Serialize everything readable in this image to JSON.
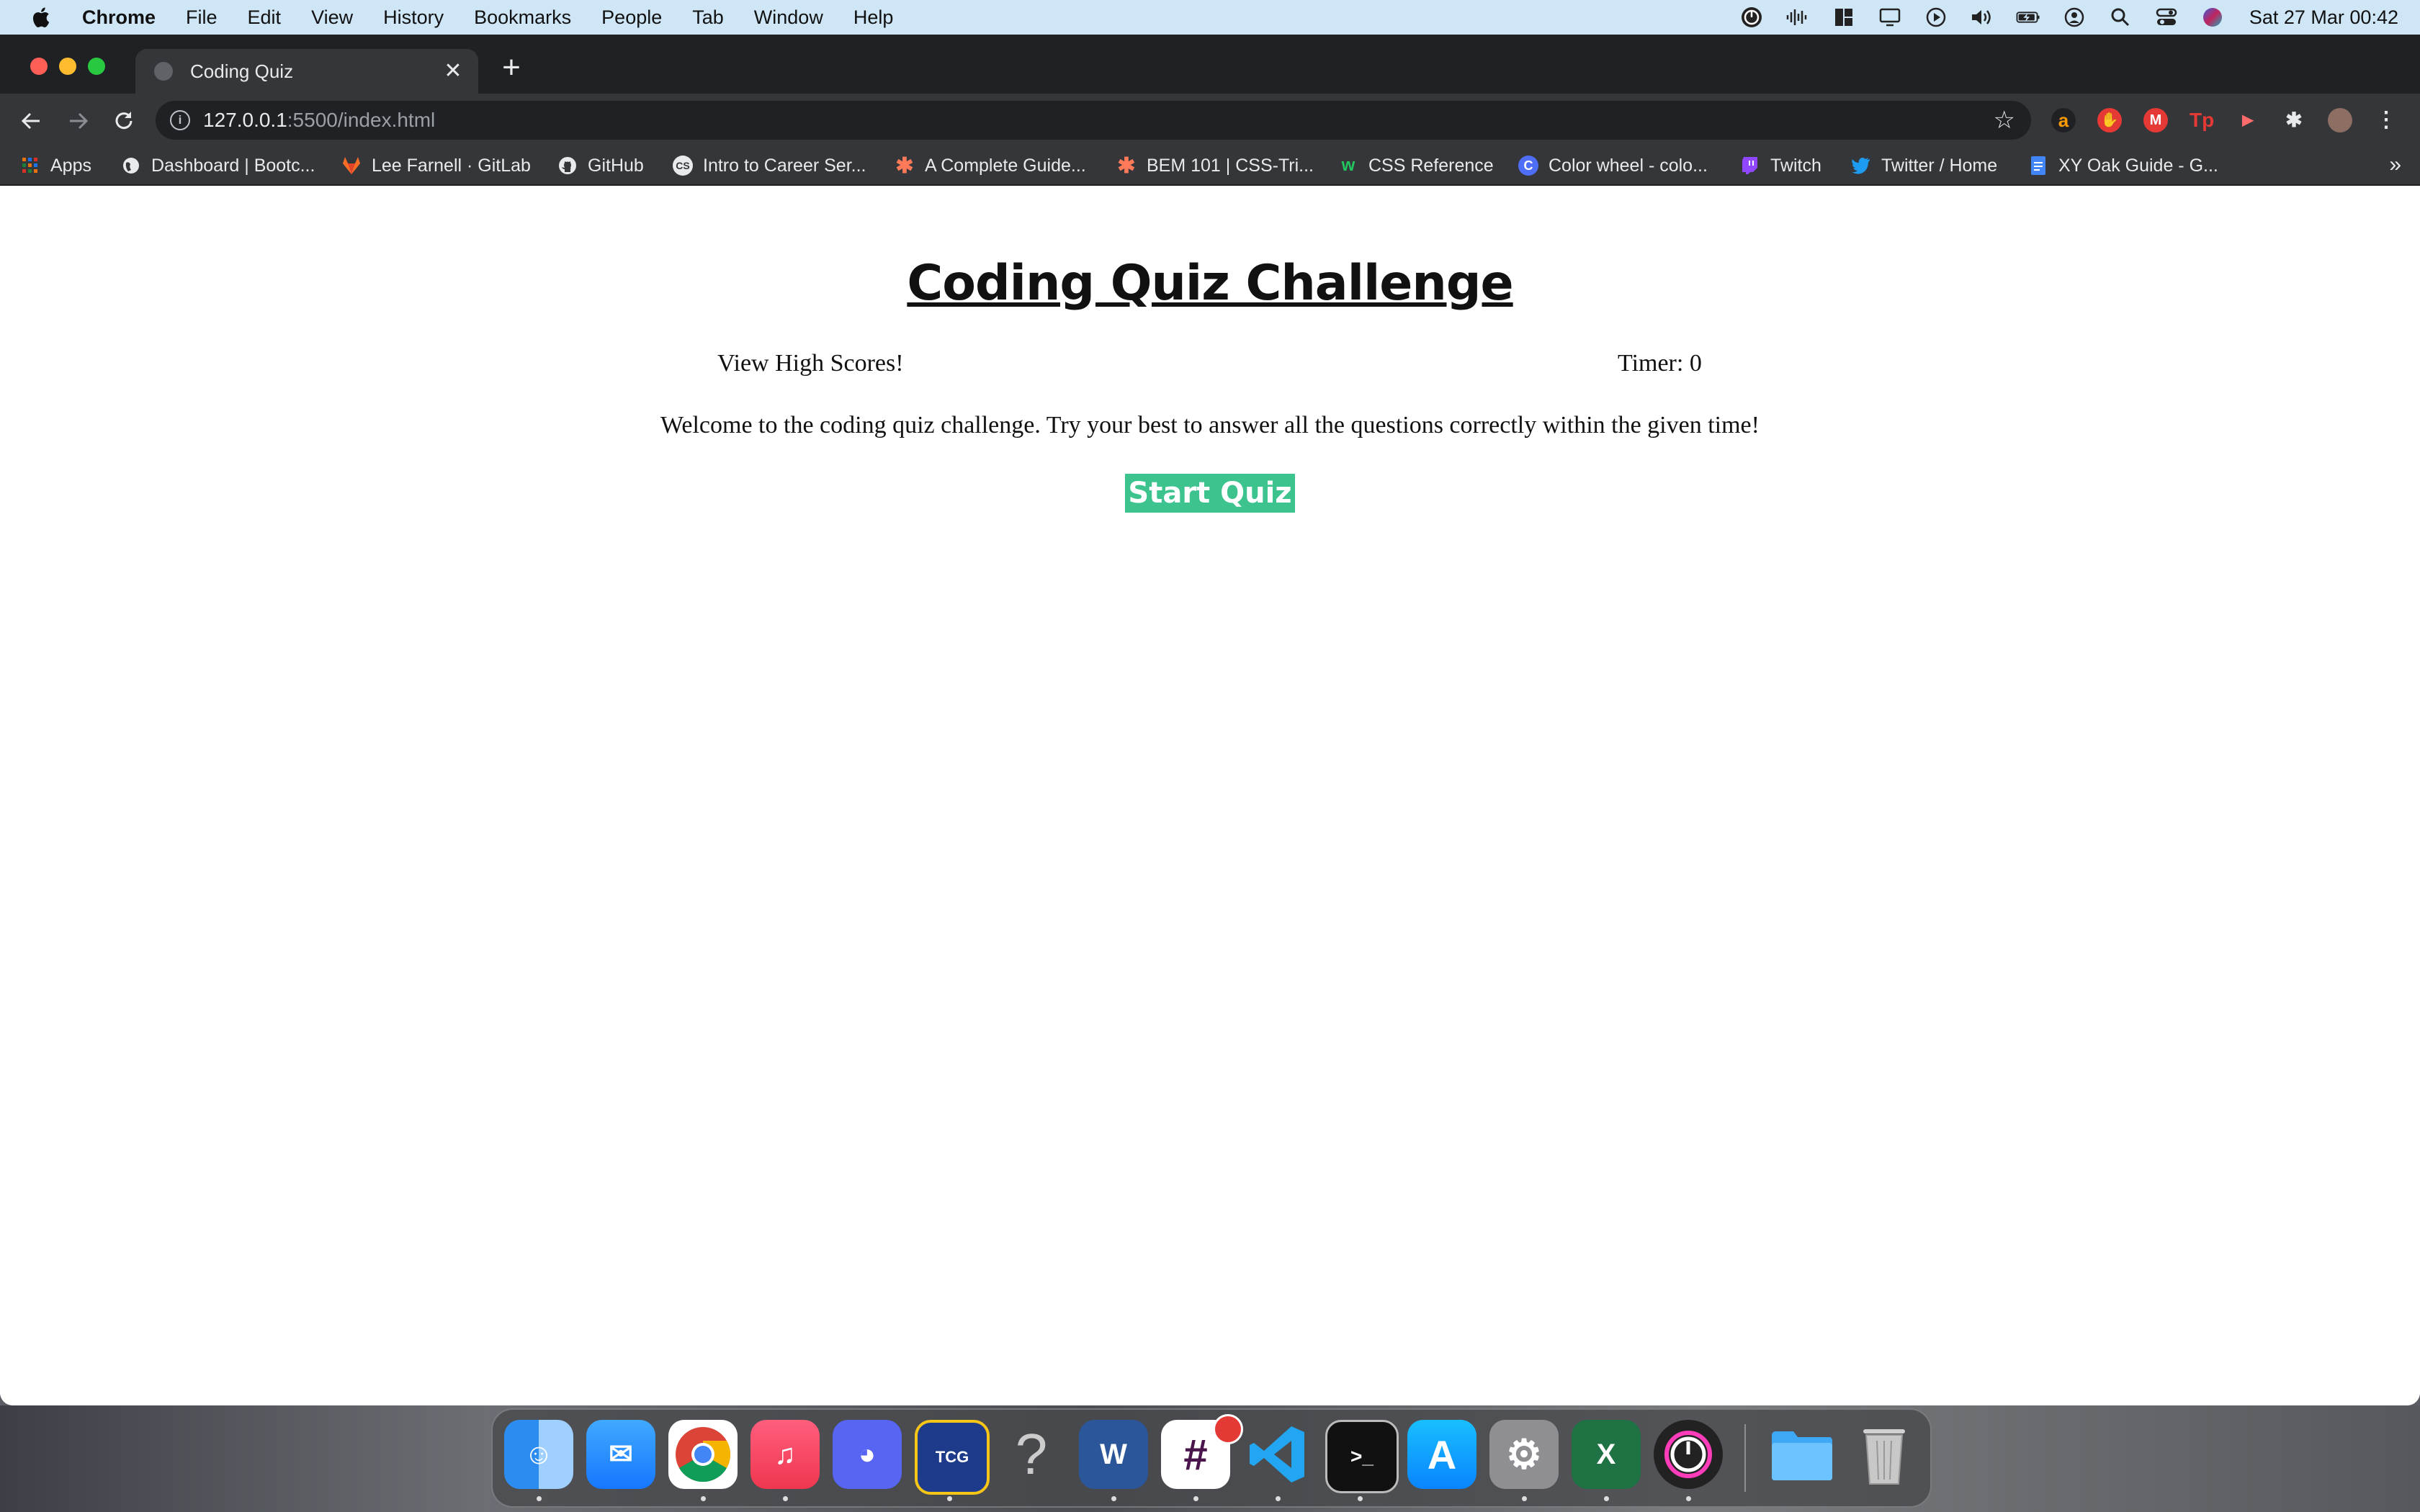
{
  "menubar": {
    "app_name": "Chrome",
    "menus": [
      "File",
      "Edit",
      "View",
      "History",
      "Bookmarks",
      "People",
      "Tab",
      "Window",
      "Help"
    ],
    "status_icons": [
      "timer-app-icon",
      "audio-waveform-icon",
      "window-tiles-icon",
      "screen-mirroring-icon",
      "play-circle-icon",
      "volume-icon",
      "battery-charging-icon",
      "user-account-icon",
      "spotlight-search-icon",
      "control-center-icon",
      "siri-icon"
    ],
    "clock": "Sat 27 Mar  00:42"
  },
  "browser": {
    "tab_title": "Coding Quiz",
    "url_host": "127.0.0.1",
    "url_path": ":5500/index.html",
    "bookmarks": [
      {
        "label": "Apps",
        "icon": "apps-grid-icon"
      },
      {
        "label": "Dashboard | Bootc...",
        "icon": "globe-icon"
      },
      {
        "label": "Lee Farnell · GitLab",
        "icon": "gitlab-icon"
      },
      {
        "label": "GitHub",
        "icon": "github-icon"
      },
      {
        "label": "Intro to Career Ser...",
        "icon": "cs-icon"
      },
      {
        "label": "A Complete Guide...",
        "icon": "asterisk-icon"
      },
      {
        "label": "BEM 101 | CSS-Tri...",
        "icon": "asterisk-icon"
      },
      {
        "label": "CSS Reference",
        "icon": "css-reference-icon"
      },
      {
        "label": "Color wheel - colo...",
        "icon": "canva-icon"
      },
      {
        "label": "Twitch",
        "icon": "twitch-icon"
      },
      {
        "label": "Twitter / Home",
        "icon": "twitter-icon"
      },
      {
        "label": "XY Oak Guide - G...",
        "icon": "google-docs-icon"
      }
    ],
    "more_bookmarks": "»"
  },
  "page": {
    "title": "Coding Quiz Challenge",
    "view_high_scores": "View High Scores!",
    "timer_label": "Timer: 0",
    "welcome_text": "Welcome to the coding quiz challenge. Try your best to answer all the questions correctly within the given time!",
    "start_button": "Start Quiz"
  },
  "dock": {
    "apps": [
      "finder-icon",
      "mail-icon",
      "chrome-icon",
      "music-icon",
      "discord-icon",
      "pokemon-tcg-icon",
      "unknown-app-icon",
      "word-icon",
      "slack-icon",
      "vscode-icon",
      "terminal-icon",
      "app-store-icon",
      "system-preferences-icon",
      "excel-icon",
      "timer-app-icon",
      "folder-icon",
      "trash-icon"
    ]
  },
  "colors": {
    "accent_button": "#3dc48e",
    "menubar": "#cfe6f7",
    "chrome_dark": "#35363a"
  }
}
